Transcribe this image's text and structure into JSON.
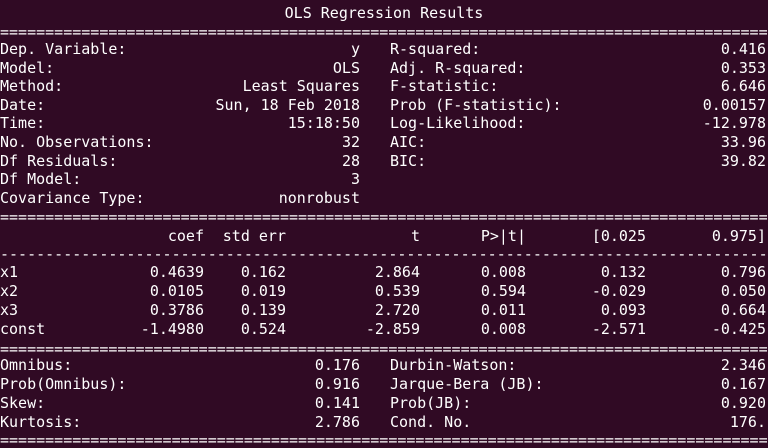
{
  "title": "OLS Regression Results",
  "rule_double": "===================================================================================================",
  "rule_single": "---------------------------------------------------------------------------------------------------",
  "summary_left": [
    {
      "label": "Dep. Variable:",
      "value": "y"
    },
    {
      "label": "Model:",
      "value": "OLS"
    },
    {
      "label": "Method:",
      "value": "Least Squares"
    },
    {
      "label": "Date:",
      "value": "Sun, 18 Feb 2018"
    },
    {
      "label": "Time:",
      "value": "15:18:50"
    },
    {
      "label": "No. Observations:",
      "value": "32"
    },
    {
      "label": "Df Residuals:",
      "value": "28"
    },
    {
      "label": "Df Model:",
      "value": "3"
    },
    {
      "label": "Covariance Type:",
      "value": "nonrobust"
    }
  ],
  "summary_right": [
    {
      "label": "R-squared:",
      "value": "0.416"
    },
    {
      "label": "Adj. R-squared:",
      "value": "0.353"
    },
    {
      "label": "F-statistic:",
      "value": "6.646"
    },
    {
      "label": "Prob (F-statistic):",
      "value": "0.00157"
    },
    {
      "label": "Log-Likelihood:",
      "value": "-12.978"
    },
    {
      "label": "AIC:",
      "value": "33.96"
    },
    {
      "label": "BIC:",
      "value": "39.82"
    }
  ],
  "coef_headers": [
    "coef",
    "std err",
    "t",
    "P>|t|",
    "[0.025",
    "0.975]"
  ],
  "coef_rows": [
    {
      "name": "x1",
      "values": [
        "0.4639",
        "0.162",
        "2.864",
        "0.008",
        "0.132",
        "0.796"
      ]
    },
    {
      "name": "x2",
      "values": [
        "0.0105",
        "0.019",
        "0.539",
        "0.594",
        "-0.029",
        "0.050"
      ]
    },
    {
      "name": "x3",
      "values": [
        "0.3786",
        "0.139",
        "2.720",
        "0.011",
        "0.093",
        "0.664"
      ]
    },
    {
      "name": "const",
      "values": [
        "-1.4980",
        "0.524",
        "-2.859",
        "0.008",
        "-2.571",
        "-0.425"
      ]
    }
  ],
  "diag_left": [
    {
      "label": "Omnibus:",
      "value": "0.176"
    },
    {
      "label": "Prob(Omnibus):",
      "value": "0.916"
    },
    {
      "label": "Skew:",
      "value": "0.141"
    },
    {
      "label": "Kurtosis:",
      "value": "2.786"
    }
  ],
  "diag_right": [
    {
      "label": "Durbin-Watson:",
      "value": "2.346"
    },
    {
      "label": "Jarque-Bera (JB):",
      "value": "0.167"
    },
    {
      "label": "Prob(JB):",
      "value": "0.920"
    },
    {
      "label": "Cond. No.",
      "value": "176."
    }
  ]
}
